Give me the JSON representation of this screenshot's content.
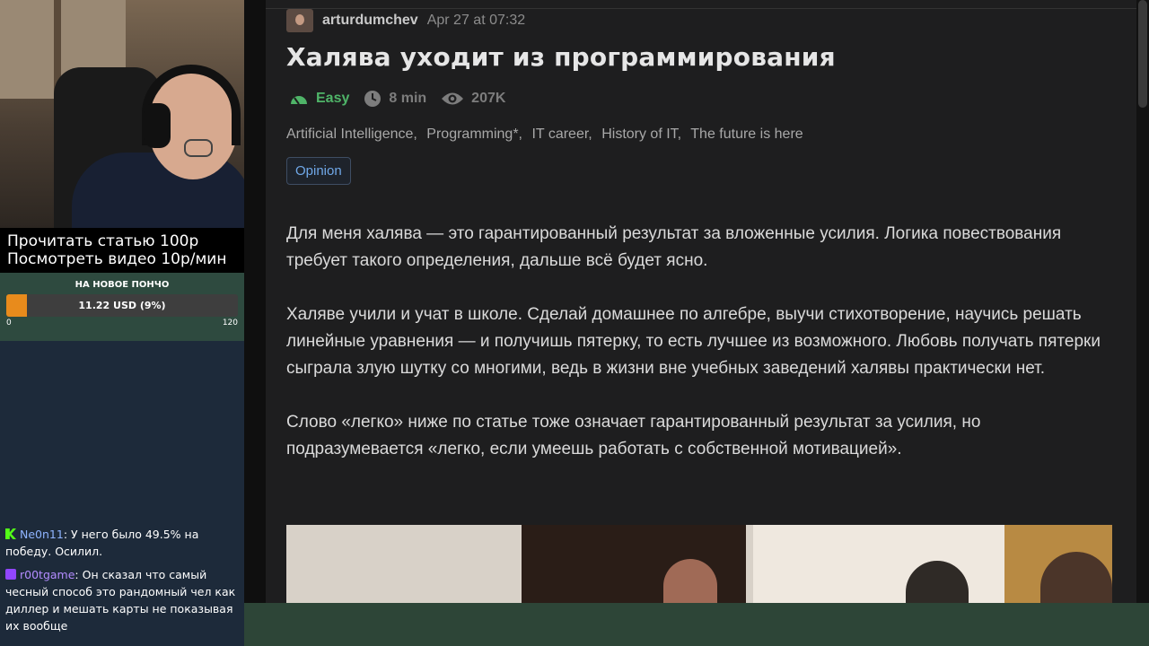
{
  "stream_overlay": {
    "promo_lines": [
      "Прочитать статью 100р",
      "Посмотреть видео 10р/мин"
    ],
    "goal": {
      "title": "НА НОВОЕ ПОНЧО",
      "amount": "11.22 USD (9%)",
      "progress_fraction": 0.09,
      "min": "0",
      "max": "120",
      "fill_color": "#e88b1c"
    },
    "chat": [
      {
        "platform": "kick",
        "badge_color": "#53fc18",
        "user": "Ne0n11",
        "user_color": "#8fb4ff",
        "text": "У него было 49.5% на победу. Осилил."
      },
      {
        "platform": "twitch",
        "badge_color": "#9146ff",
        "user": "r00tgame",
        "user_color": "#b38cff",
        "text": "Он сказал что самый чесный способ это рандомный чел как диллер и мешать карты не показывая их вообще"
      }
    ]
  },
  "article": {
    "author": "arturdumchev",
    "date": "Apr 27 at 07:32",
    "title": "Халява уходит из программирования",
    "difficulty": "Easy",
    "difficulty_color": "#4fb468",
    "reading_time": "8 min",
    "views": "207K",
    "hubs": [
      "Artificial Intelligence,",
      "Programming*,",
      "IT career,",
      "History of IT,",
      "The future is here"
    ],
    "label": "Opinion",
    "paragraphs": [
      "Для меня халява — это гарантированный результат за вложенные усилия. Логика повествования требует такого определения, дальше всё будет ясно.",
      "Халяве учили и учат в школе. Сделай домашнее по алгебре, выучи стихотворение, научись решать линейные уравнения — и получишь пятерку, то есть лучшее из возможного. Любовь получать пятерки сыграла злую шутку со многими, ведь в жизни вне учебных заведений халявы практически нет.",
      "Слово «легко» ниже по статье тоже означает гарантированный результат за усилия, но подразумевается «легко, если умеешь работать с собственной мотивацией»."
    ]
  },
  "icons": {
    "difficulty": "difficulty-icon",
    "reading_time": "clock-icon",
    "views": "eye-icon"
  }
}
